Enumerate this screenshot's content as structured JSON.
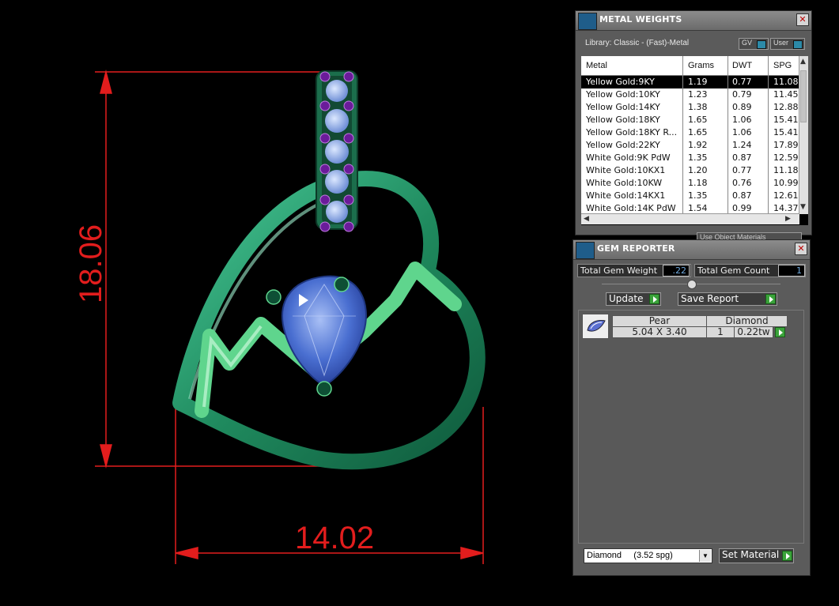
{
  "viewport": {
    "dim_vertical": "18.06",
    "dim_horizontal": "14.02",
    "colors": {
      "dimension": "#e21d1d",
      "metal": "#1f8a5e",
      "gem": "#4a6fd1",
      "prongs": "#6a1b9a"
    }
  },
  "metal_weights": {
    "title": "METAL WEIGHTS",
    "close": "✕",
    "library": "Library: Classic - (Fast)-Metal",
    "toggles": [
      "GV",
      "User"
    ],
    "columns": [
      "Metal",
      "Grams",
      "DWT",
      "SPG"
    ],
    "rows": [
      {
        "metal": "Yellow Gold:9KY",
        "grams": "1.19",
        "dwt": "0.77",
        "spg": "11.08"
      },
      {
        "metal": "Yellow Gold:10KY",
        "grams": "1.23",
        "dwt": "0.79",
        "spg": "11.45"
      },
      {
        "metal": "Yellow Gold:14KY",
        "grams": "1.38",
        "dwt": "0.89",
        "spg": "12.88"
      },
      {
        "metal": "Yellow Gold:18KY",
        "grams": "1.65",
        "dwt": "1.06",
        "spg": "15.41"
      },
      {
        "metal": "Yellow Gold:18KY R...",
        "grams": "1.65",
        "dwt": "1.06",
        "spg": "15.41"
      },
      {
        "metal": "Yellow Gold:22KY",
        "grams": "1.92",
        "dwt": "1.24",
        "spg": "17.89"
      },
      {
        "metal": "White Gold:9K PdW",
        "grams": "1.35",
        "dwt": "0.87",
        "spg": "12.59"
      },
      {
        "metal": "White Gold:10KX1",
        "grams": "1.20",
        "dwt": "0.77",
        "spg": "11.18"
      },
      {
        "metal": "White Gold:10KW",
        "grams": "1.18",
        "dwt": "0.76",
        "spg": "10.99"
      },
      {
        "metal": "White Gold:14KX1",
        "grams": "1.35",
        "dwt": "0.87",
        "spg": "12.61"
      },
      {
        "metal": "White Gold:14K PdW",
        "grams": "1.54",
        "dwt": "0.99",
        "spg": "14.37"
      }
    ],
    "use_object_materials": "Use Object Materials"
  },
  "gem_reporter": {
    "title": "GEM REPORTER",
    "close": "✕",
    "total_gem_weight_label": "Total Gem Weight",
    "total_gem_weight": ".22",
    "total_gem_count_label": "Total Gem Count",
    "total_gem_count": "1",
    "update_label": "Update",
    "save_report_label": "Save Report",
    "gems": [
      {
        "shape": "Pear",
        "material": "Diamond",
        "size": "5.04 X 3.40",
        "count": "1",
        "weight": "0.22tw"
      }
    ],
    "material_select": "Diamond     (3.52 spg)",
    "set_material_label": "Set Material"
  }
}
